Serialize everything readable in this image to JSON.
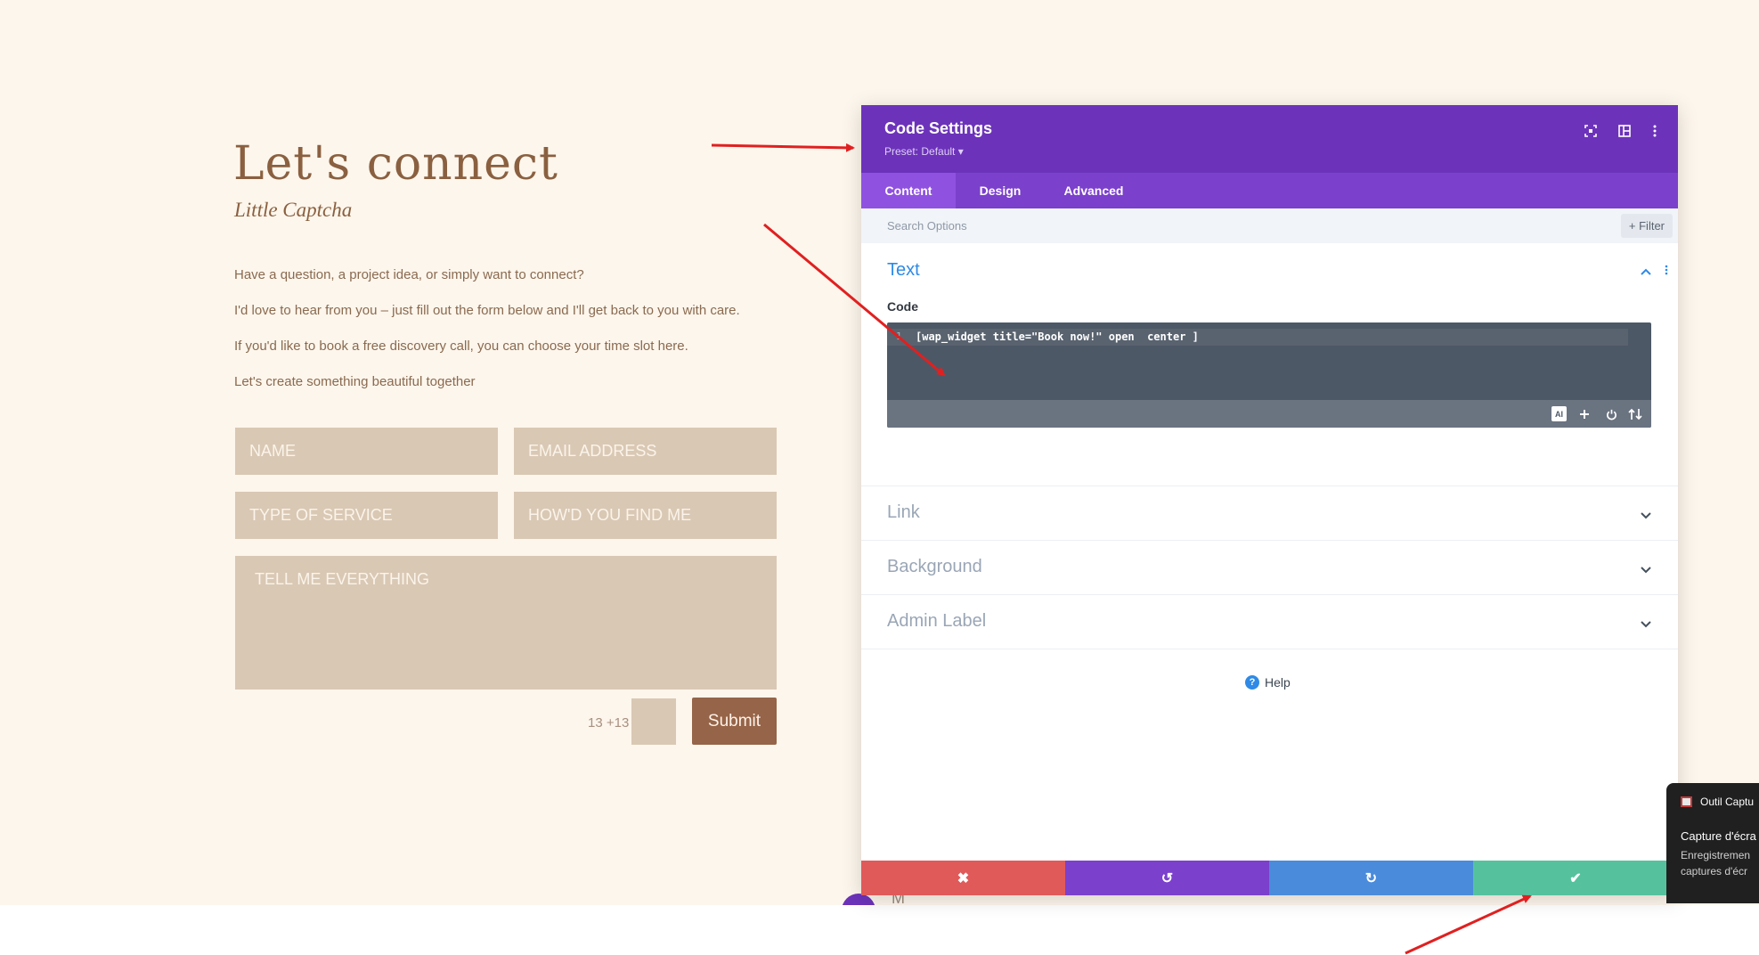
{
  "form_page": {
    "heading": "Let's connect",
    "subheading": "Little Captcha",
    "paragraphs": [
      "Have a question, a project idea, or simply want to connect?",
      "I'd love to hear from you – just fill out the form below and I'll get back to you with care.",
      "If you'd like to book a free discovery call, you can choose your time slot here.",
      "Let's create something beautiful together"
    ],
    "fields": {
      "name": "NAME",
      "email": "EMAIL ADDRESS",
      "service": "TYPE OF SERVICE",
      "how_found": "HOW'D YOU FIND ME",
      "message": "TELL ME EVERYTHING"
    },
    "captcha_label": "13 +13 =",
    "submit_label": "Submit"
  },
  "panel": {
    "title": "Code Settings",
    "preset": "Preset: Default ▾",
    "tabs": [
      "Content",
      "Design",
      "Advanced"
    ],
    "active_tab": "Content",
    "search_placeholder": "Search Options",
    "filter_label": "+ Filter",
    "sections": {
      "text": "Text",
      "link": "Link",
      "background": "Background",
      "admin_label": "Admin Label"
    },
    "code_label": "Code",
    "code_line_number": "1",
    "code_value": "[wap_widget title=\"Book now!\" open  center ]",
    "help_label": "Help",
    "icons": [
      "focus-icon",
      "split-view-icon",
      "kebab-menu-icon",
      "ai-icon",
      "plus-icon",
      "power-icon",
      "sort-icon"
    ]
  },
  "action_bar": {
    "cancel_color": "#e05a5a",
    "undo_color": "#7b40cc",
    "redo_color": "#4a8bdb",
    "save_color": "#55c29d",
    "cancel_icon": "✖",
    "undo_icon": "↺",
    "redo_icon": "↻",
    "save_icon": "✔"
  },
  "toast": {
    "app_name": "Outil Captu",
    "title": "Capture d'écra",
    "body_line1": "Enregistremen",
    "body_line2": "captures d'écr"
  },
  "bottom_letter": "M",
  "colors": {
    "accent_purple": "#6c33ba",
    "page_bg": "#fdf6ec",
    "field_bg": "#d9c8b4",
    "submit_bg": "#966448",
    "annotation_red": "#e02020"
  }
}
